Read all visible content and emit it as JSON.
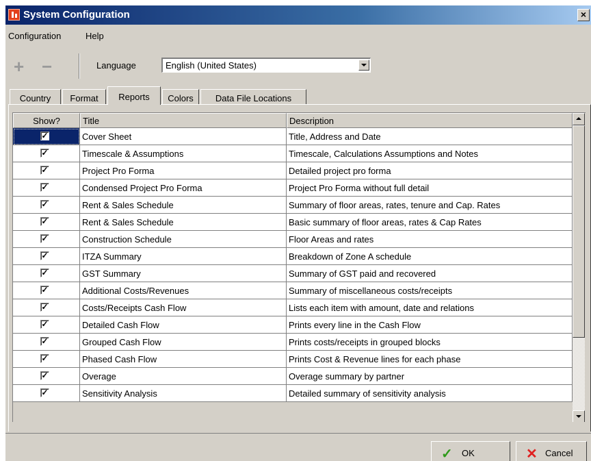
{
  "window": {
    "title": "System Configuration",
    "close_glyph": "×"
  },
  "menu": {
    "items": [
      {
        "label": "Configuration"
      },
      {
        "label": "Help"
      }
    ]
  },
  "toolbar": {
    "add_icon": "plus-icon",
    "remove_icon": "minus-icon",
    "language_label": "Language",
    "language_value": "English (United States)"
  },
  "tabs": [
    {
      "label": "Country",
      "active": false
    },
    {
      "label": "Format",
      "active": false
    },
    {
      "label": "Reports",
      "active": true
    },
    {
      "label": "Colors",
      "active": false
    },
    {
      "label": "Data File Locations",
      "active": false
    }
  ],
  "grid": {
    "columns": {
      "show": "Show?",
      "title": "Title",
      "description": "Description"
    },
    "rows": [
      {
        "show": true,
        "title": "Cover Sheet",
        "description": "Title, Address and Date"
      },
      {
        "show": true,
        "title": "Timescale & Assumptions",
        "description": "Timescale, Calculations Assumptions and Notes"
      },
      {
        "show": true,
        "title": "Project Pro Forma",
        "description": "Detailed project pro forma"
      },
      {
        "show": true,
        "title": "Condensed Project Pro Forma",
        "description": "Project Pro Forma without full detail"
      },
      {
        "show": true,
        "title": "Rent & Sales Schedule",
        "description": "Summary of floor areas, rates, tenure and Cap. Rates"
      },
      {
        "show": true,
        "title": "Rent & Sales Schedule",
        "description": "Basic summary of floor areas, rates & Cap Rates"
      },
      {
        "show": true,
        "title": "Construction Schedule",
        "description": "Floor Areas and rates"
      },
      {
        "show": true,
        "title": "ITZA Summary",
        "description": "Breakdown of Zone A schedule"
      },
      {
        "show": true,
        "title": "GST Summary",
        "description": "Summary of GST paid and recovered"
      },
      {
        "show": true,
        "title": "Additional Costs/Revenues",
        "description": "Summary of miscellaneous costs/receipts"
      },
      {
        "show": true,
        "title": "Costs/Receipts Cash Flow",
        "description": "Lists each item with amount, date and relations"
      },
      {
        "show": true,
        "title": "Detailed Cash Flow",
        "description": "Prints every line in the Cash Flow"
      },
      {
        "show": true,
        "title": "Grouped Cash Flow",
        "description": "Prints costs/receipts in grouped blocks"
      },
      {
        "show": true,
        "title": "Phased Cash Flow",
        "description": "Prints Cost & Revenue lines for each phase"
      },
      {
        "show": true,
        "title": "Overage",
        "description": "Overage summary by partner"
      },
      {
        "show": true,
        "title": "Sensitivity Analysis",
        "description": "Detailed summary of sensitivity analysis"
      }
    ]
  },
  "footer": {
    "ok_label": "OK",
    "cancel_label": "Cancel"
  },
  "colors": {
    "title_bar": "#0a246a",
    "selection": "#0a246a",
    "ok_icon": "#2f9a1b",
    "cancel_icon": "#e02020"
  }
}
